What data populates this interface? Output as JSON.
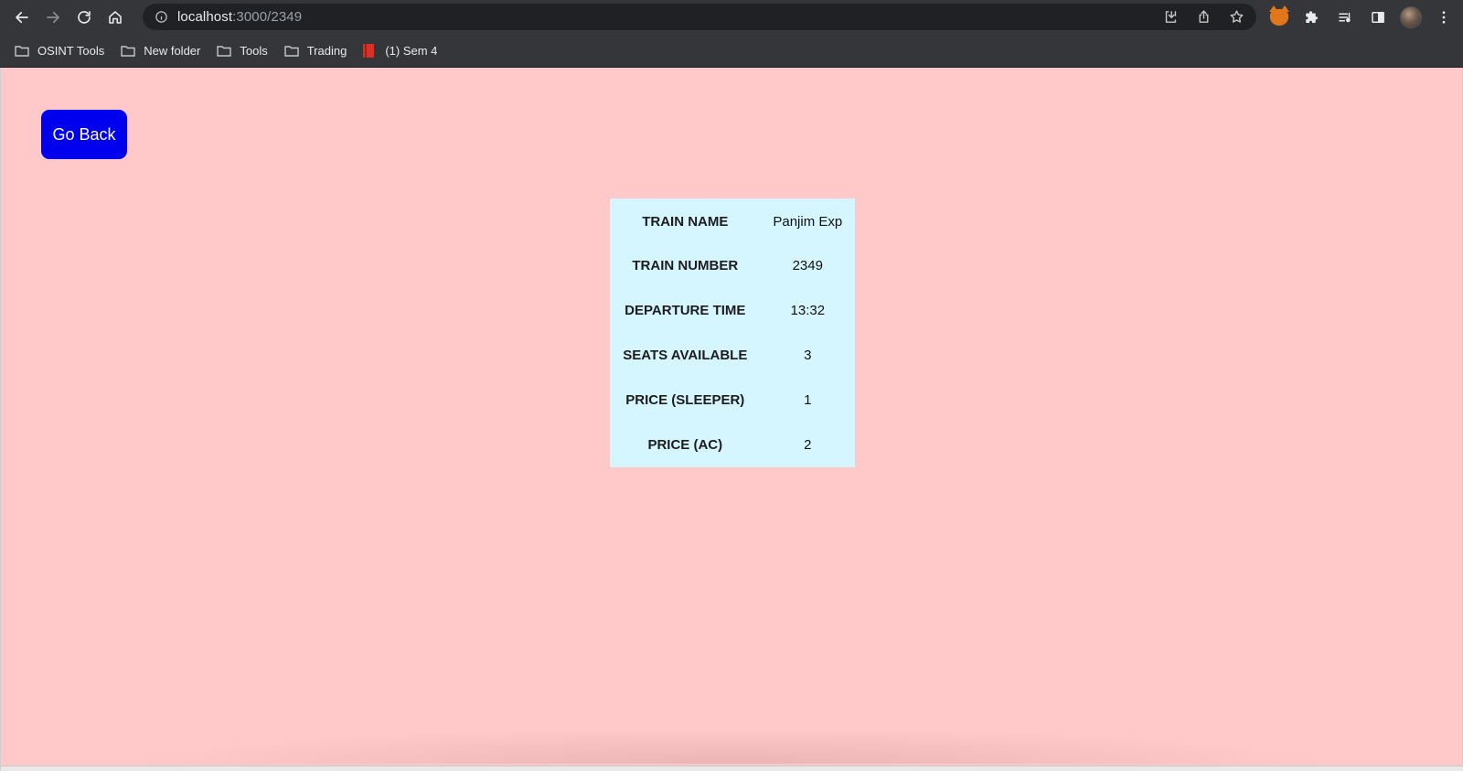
{
  "browser": {
    "url_host": "localhost",
    "url_path": ":3000/2349",
    "bookmarks": [
      {
        "label": "OSINT Tools",
        "icon": "folder-icon"
      },
      {
        "label": "New folder",
        "icon": "folder-icon"
      },
      {
        "label": "Tools",
        "icon": "folder-icon"
      },
      {
        "label": "Trading",
        "icon": "folder-icon"
      },
      {
        "label": "(1) Sem 4",
        "icon": "book-icon"
      }
    ]
  },
  "page": {
    "background_color": "#ffc9c9",
    "go_back_label": "Go Back",
    "go_back_color": "#0000ee",
    "card_color": "#d6f6ff",
    "details": [
      {
        "key": "TRAIN NAME",
        "value": "Panjim Exp"
      },
      {
        "key": "TRAIN NUMBER",
        "value": "2349"
      },
      {
        "key": "DEPARTURE TIME",
        "value": "13:32"
      },
      {
        "key": "SEATS AVAILABLE",
        "value": "3"
      },
      {
        "key": "PRICE (SLEEPER)",
        "value": "1"
      },
      {
        "key": "PRICE (AC)",
        "value": "2"
      }
    ]
  }
}
